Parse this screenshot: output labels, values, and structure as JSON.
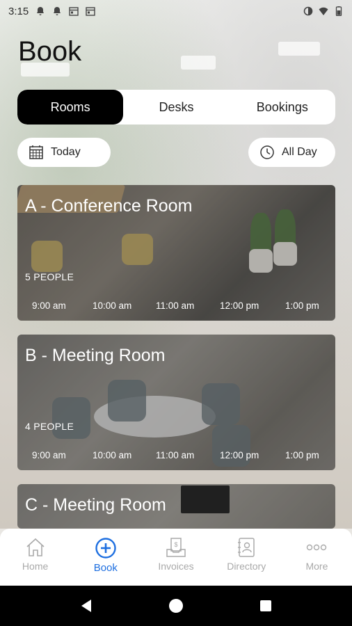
{
  "status_bar": {
    "time": "3:15",
    "icons_left": [
      "notification-bell-icon",
      "notification-bell-icon",
      "calendar-icon",
      "calendar-icon"
    ],
    "icons_right": [
      "data-saver-icon",
      "wifi-icon",
      "battery-icon"
    ]
  },
  "page": {
    "title": "Book"
  },
  "tabs": [
    {
      "label": "Rooms",
      "active": true
    },
    {
      "label": "Desks",
      "active": false
    },
    {
      "label": "Bookings",
      "active": false
    }
  ],
  "filters": {
    "date": {
      "label": "Today",
      "icon": "calendar-grid-icon"
    },
    "duration": {
      "label": "All Day",
      "icon": "clock-icon"
    }
  },
  "rooms": [
    {
      "name": "A - Conference Room",
      "capacity": "5 PEOPLE",
      "times": [
        "9:00 am",
        "10:00 am",
        "11:00 am",
        "12:00 pm",
        "1:00 pm"
      ]
    },
    {
      "name": "B - Meeting Room",
      "capacity": "4 PEOPLE",
      "times": [
        "9:00 am",
        "10:00 am",
        "11:00 am",
        "12:00 pm",
        "1:00 pm"
      ]
    },
    {
      "name": "C - Meeting Room"
    }
  ],
  "bottom_nav": [
    {
      "label": "Home",
      "icon": "home-icon",
      "active": false
    },
    {
      "label": "Book",
      "icon": "plus-circle-icon",
      "active": true
    },
    {
      "label": "Invoices",
      "icon": "invoice-tray-icon",
      "active": false
    },
    {
      "label": "Directory",
      "icon": "contacts-book-icon",
      "active": false
    },
    {
      "label": "More",
      "icon": "more-dots-icon",
      "active": false
    }
  ],
  "system_nav": [
    "back-icon",
    "home-circle-icon",
    "recents-square-icon"
  ],
  "colors": {
    "accent": "#1e6fe0",
    "active_tab": "#000000",
    "inactive_nav": "#a9a9a9"
  }
}
